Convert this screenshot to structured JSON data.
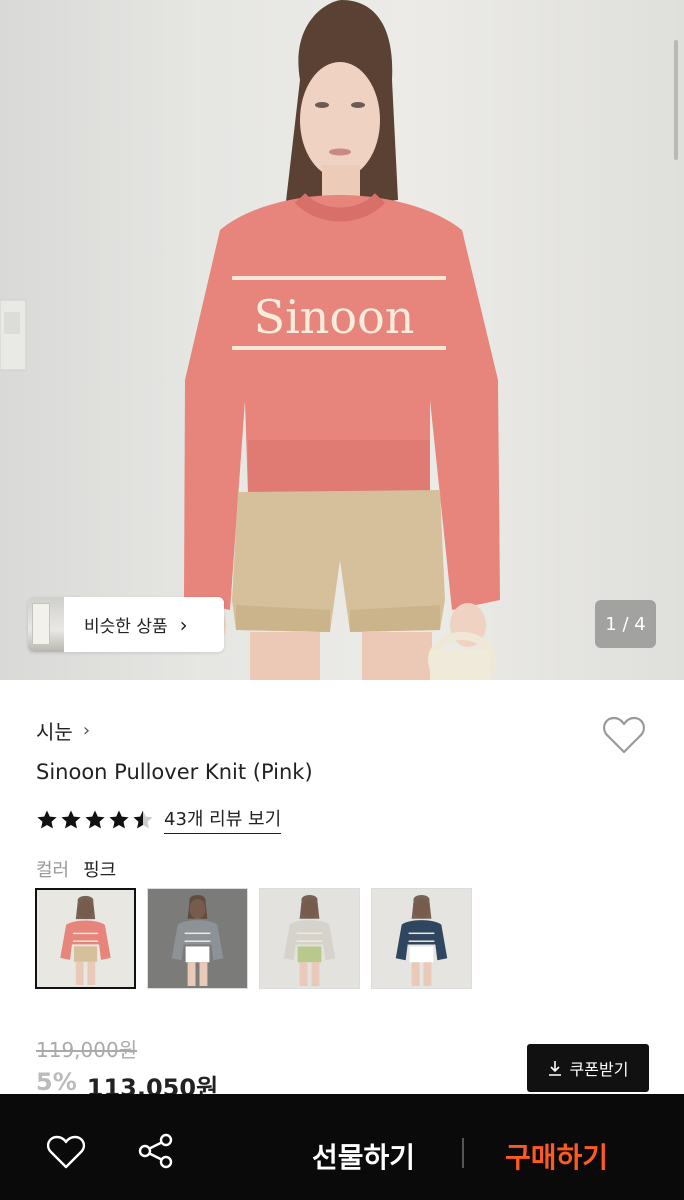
{
  "hero": {
    "logo_text": "Sinoon",
    "similar_label": "비슷한 상품",
    "counter": "1 / 4",
    "current_image": 1,
    "total_images": 4
  },
  "product": {
    "brand": "시눈",
    "title": "Sinoon Pullover Knit (Pink)",
    "rating": 4.5,
    "review_link": "43개 리뷰 보기",
    "color_label": "컬러",
    "color_value": "핑크",
    "swatch_colors": [
      "#e7847c",
      "#8d9297",
      "#d6d3cd",
      "#2f4660"
    ],
    "selected_swatch": 0
  },
  "price": {
    "original": "119,000원",
    "discount": "5%",
    "sale": "113,050원",
    "coupon_label": "쿠폰받기"
  },
  "bottom_bar": {
    "gift_label": "선물하기",
    "buy_label": "구매하기",
    "buy_color": "#ff5a1f"
  },
  "icons": [
    "heart-icon",
    "share-icon",
    "download-icon",
    "chevron-right-icon",
    "star-icon"
  ]
}
